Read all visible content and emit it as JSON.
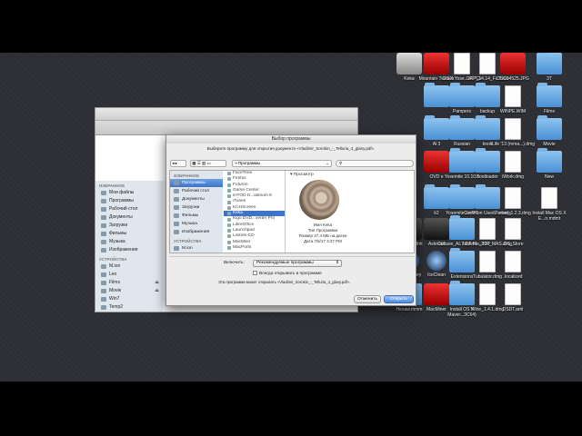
{
  "desktop_icons": [
    {
      "label": "Keka",
      "col": 0,
      "row": 0,
      "kind": "disk"
    },
    {
      "label": "Mountain Tweaks",
      "col": 1,
      "row": 0,
      "kind": "red"
    },
    {
      "label": "OS X Yose...el PCs",
      "col": 2,
      "row": 0,
      "kind": "doc"
    },
    {
      "label": "DRP_14.14_Fu ll.iso",
      "col": 3,
      "row": 0,
      "kind": "doc"
    },
    {
      "label": "DSC04525.JPG",
      "col": 4,
      "row": 0,
      "kind": "red"
    },
    {
      "label": "3T",
      "col": 5,
      "row": 0,
      "kind": "folder"
    },
    {
      "label": "",
      "col": 1,
      "row": 1,
      "kind": "folder"
    },
    {
      "label": "Pampers",
      "col": 2,
      "row": 1,
      "kind": "folder"
    },
    {
      "label": "backup",
      "col": 3,
      "row": 1,
      "kind": "folder"
    },
    {
      "label": "WINPE.WIM",
      "col": 4,
      "row": 1,
      "kind": "doc"
    },
    {
      "label": "Films",
      "col": 5,
      "row": 1,
      "kind": "folder"
    },
    {
      "label": "Al 3",
      "col": 1,
      "row": 2,
      "kind": "folder"
    },
    {
      "label": "Russian",
      "col": 2,
      "row": 2,
      "kind": "folder"
    },
    {
      "label": "book",
      "col": 3,
      "row": 2,
      "kind": "folder"
    },
    {
      "label": "iLife '13 (mma...).dmg",
      "col": 4,
      "row": 2,
      "kind": "doc"
    },
    {
      "label": "Movie",
      "col": 5,
      "row": 2,
      "kind": "folder"
    },
    {
      "label": "OVD e",
      "col": 1,
      "row": 3,
      "kind": "red"
    },
    {
      "label": "Yosemite 10.10.5",
      "col": 2,
      "row": 3,
      "kind": "folder"
    },
    {
      "label": "bootloader",
      "col": 3,
      "row": 3,
      "kind": "folder"
    },
    {
      "label": "iWork.dmg",
      "col": 4,
      "row": 3,
      "kind": "doc"
    },
    {
      "label": "New",
      "col": 5,
      "row": 3,
      "kind": "folder"
    },
    {
      "label": "k2",
      "col": 1,
      "row": 4,
      "kind": "folder"
    },
    {
      "label": "Yosemite on PC",
      "col": 2,
      "row": 4,
      "kind": "folder"
    },
    {
      "label": "Common Used....rmats",
      "col": 3,
      "row": 4,
      "kind": "folder"
    },
    {
      "label": "Perian_1.2.3.dmg",
      "col": 4,
      "row": 4,
      "kind": "doc"
    },
    {
      "label": "Install Mac OS X E...n.mdmt",
      "col": 5,
      "row": 4,
      "kind": "doc"
    },
    {
      "label": "Новый.mdmt",
      "col": 0,
      "row": 5,
      "kind": "dark"
    },
    {
      "label": "Asteroid",
      "col": 1,
      "row": 5,
      "kind": "dark"
    },
    {
      "label": "Cubase_AL7.0.6.M....P2P",
      "col": 2,
      "row": 5,
      "kind": "folder"
    },
    {
      "label": "tableme_100_MAS.dmg",
      "col": 3,
      "row": 5,
      "kind": "doc"
    },
    {
      "label": ".DS_Store",
      "col": 4,
      "row": 5,
      "kind": "doc"
    },
    {
      "label": "SeaMonkey",
      "col": 0,
      "row": 6,
      "kind": "blue-circle"
    },
    {
      "label": "IceClean",
      "col": 1,
      "row": 6,
      "kind": "blue-circle"
    },
    {
      "label": "Extensions",
      "col": 2,
      "row": 6,
      "kind": "folder"
    },
    {
      "label": "Tubulator.dmg",
      "col": 3,
      "row": 6,
      "kind": "doc"
    },
    {
      "label": ".localized",
      "col": 4,
      "row": 6,
      "kind": "doc"
    },
    {
      "label": "Hexaw.mmm",
      "col": 0,
      "row": 7,
      "kind": "folder"
    },
    {
      "label": "MacMiner",
      "col": 1,
      "row": 7,
      "kind": "red"
    },
    {
      "label": "Install OS X Maver...3C64)",
      "col": 2,
      "row": 7,
      "kind": "folder"
    },
    {
      "label": "Wine_1.4.1.dmg",
      "col": 3,
      "row": 7,
      "kind": "doc"
    },
    {
      "label": "DSDT.aml",
      "col": 4,
      "row": 7,
      "kind": "doc"
    }
  ],
  "finder": {
    "favorites_header": "ИЗБРАННОЕ",
    "favorites": [
      "Мои файлы",
      "Программы",
      "Рабочий стол",
      "Документы",
      "Загрузки",
      "Фильмы",
      "Музыка",
      "Изображения"
    ],
    "devices_header": "УСТРОЙСТВА",
    "devices": [
      {
        "label": "M.ion",
        "eject": ""
      },
      {
        "label": "Leo",
        "eject": ""
      },
      {
        "label": "Films",
        "eject": "⏏"
      },
      {
        "label": "Movie",
        "eject": "⏏"
      },
      {
        "label": "Win7",
        "eject": ""
      },
      {
        "label": "Temp2",
        "eject": ""
      }
    ]
  },
  "dialog": {
    "title": "Выбор программы",
    "prompt": "Выберите программу для открытия документа «Vladimir_Sorokin_-_Telluria_4_glavy.pdf».",
    "location": "Программы",
    "search_placeholder": "",
    "sidebar_favorites_header": "ИЗБРАННОЕ",
    "sidebar_favorites": [
      "Программы",
      "Рабочий стол",
      "Документы",
      "Загрузки",
      "Фильмы",
      "Музыка",
      "Изображения"
    ],
    "sidebar_devices_header": "УСТРОЙСТВА",
    "sidebar_devices": [
      "M.ion"
    ],
    "apps": [
      "FaceTime",
      "Firefox",
      "Futuron",
      "Game Center",
      "iHTOD D...latinum 6",
      "iTunes",
      "KCHScreen",
      "Keka",
      "Kigo DVD...verter Pro",
      "LibreOffice",
      "Launchpad",
      "Linkoln-CD",
      "MacMiler",
      "MacPorts"
    ],
    "selected_app_index": 7,
    "preview_header": "Просмотр",
    "preview_name": "Имя  Keka",
    "preview_kind": "Тип  Программа",
    "preview_size": "Размер  27,4 МБ на диске",
    "preview_date": "Дата  7/6/17 3:27 PM",
    "enable_label": "Включить:",
    "enable_value": "Рекомендуемые программы",
    "always_open_label": "Всегда открывать в программе",
    "note": "Эта программа может открывать «Vladimir_Sorokin_-_Telluria_4_glavy.pdf».",
    "cancel_label": "Отменить",
    "open_label": "Открыть"
  },
  "dock_colors": [
    "#b35",
    "#bbb",
    "#8a8",
    "#777",
    "#48c",
    "#999",
    "#555",
    "#c33",
    "#eee",
    "#aaa",
    "#3a8",
    "#57d",
    "#ddd",
    "#c60",
    "#333",
    "#88a",
    "#ccc",
    "#58c",
    "#d55",
    "#999",
    "#b9b",
    "#444"
  ]
}
